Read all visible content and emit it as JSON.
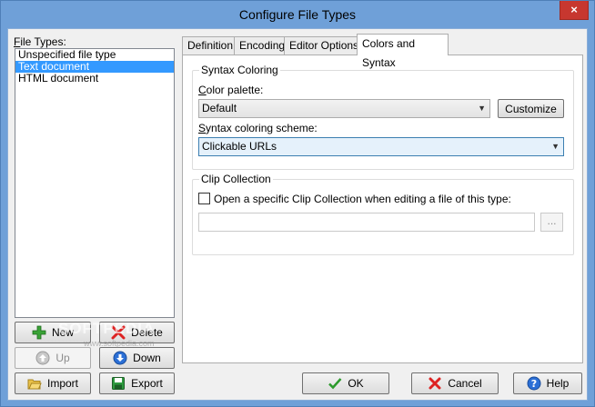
{
  "window": {
    "title": "Configure File Types",
    "close_glyph": "×"
  },
  "file_types": {
    "label_accel": "F",
    "label_rest": "ile Types:",
    "items": [
      "Unspecified file type",
      "Text document",
      "HTML document"
    ],
    "selected_index": 1
  },
  "list_buttons": {
    "new": "New",
    "delete": "Delete",
    "up": "Up",
    "down": "Down",
    "import": "Import",
    "export": "Export"
  },
  "tabs": [
    "Definition",
    "Encoding",
    "Editor Options",
    "Colors and Syntax"
  ],
  "active_tab": 3,
  "syntax_coloring": {
    "group_title": "Syntax Coloring",
    "palette_label_accel": "C",
    "palette_label_rest": "olor palette:",
    "palette_value": "Default",
    "customize_label": "Customize",
    "scheme_label_accel": "S",
    "scheme_label_rest": "yntax coloring scheme:",
    "scheme_value": "Clickable URLs"
  },
  "clip_collection": {
    "group_title": "Clip Collection",
    "checkbox_label": "Open a specific Clip Collection when editing a file of this type:",
    "checked": false,
    "path_value": "",
    "browse_label": "..."
  },
  "dialog_buttons": {
    "ok": "OK",
    "cancel": "Cancel",
    "help": "Help"
  },
  "watermark": {
    "main": "SOFTPEDIA",
    "sub": "www.softpedia.com"
  },
  "colors": {
    "selection": "#3399ff",
    "title_bg": "#6fa0d8",
    "close_bg": "#c7372f"
  }
}
